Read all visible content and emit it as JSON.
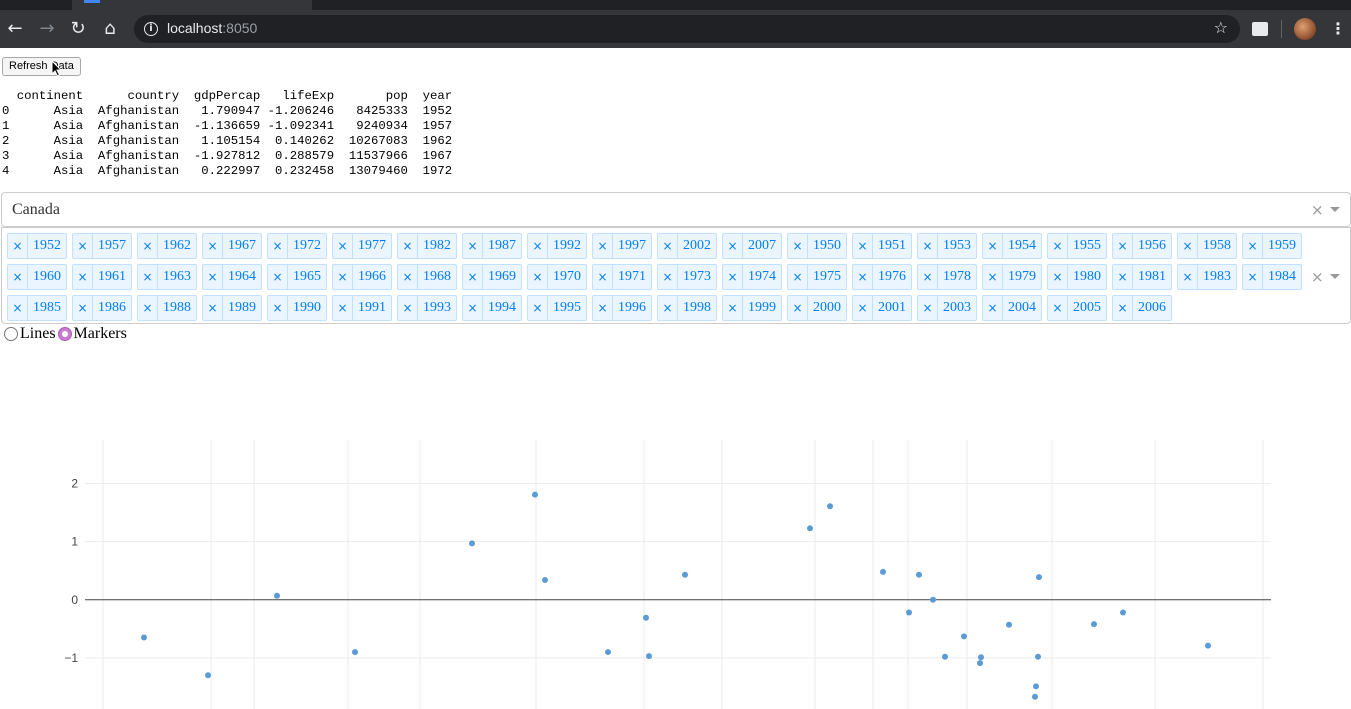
{
  "browser": {
    "url_host": "localhost",
    "url_port": ":8050"
  },
  "refresh_button": {
    "label": "Refresh Data"
  },
  "dataframe_preview": {
    "text": "  continent      country  gdpPercap   lifeExp       pop  year\n0      Asia  Afghanistan   1.790947 -1.206246   8425333  1952\n1      Asia  Afghanistan  -1.136659 -1.092341   9240934  1957\n2      Asia  Afghanistan   1.105154  0.140262  10267083  1962\n3      Asia  Afghanistan  -1.927812  0.288579  11537966  1967\n4      Asia  Afghanistan   0.222997  0.232458  13079460  1972"
  },
  "country_dropdown": {
    "selected": "Canada",
    "clear_glyph": "×"
  },
  "year_dropdown": {
    "clear_glyph": "×",
    "chip_remove_glyph": "×",
    "selected": [
      "1952",
      "1957",
      "1962",
      "1967",
      "1972",
      "1977",
      "1982",
      "1987",
      "1992",
      "1997",
      "2002",
      "2007",
      "1950",
      "1951",
      "1953",
      "1954",
      "1955",
      "1956",
      "1958",
      "1959",
      "1960",
      "1961",
      "1963",
      "1964",
      "1965",
      "1966",
      "1968",
      "1969",
      "1970",
      "1971",
      "1973",
      "1974",
      "1975",
      "1976",
      "1978",
      "1979",
      "1980",
      "1981",
      "1983",
      "1984",
      "1985",
      "1986",
      "1988",
      "1989",
      "1990",
      "1991",
      "1993",
      "1994",
      "1995",
      "1996",
      "1998",
      "1999",
      "2000",
      "2001",
      "2003",
      "2004",
      "2005",
      "2006"
    ]
  },
  "mode_radio": {
    "options": [
      {
        "label": "Lines",
        "checked": false
      },
      {
        "label": "Markers",
        "checked": true
      }
    ]
  },
  "chart_data": {
    "type": "scatter",
    "y_ticks": [
      "2",
      "1",
      "0",
      "−1"
    ],
    "y_tick_values": [
      2,
      1,
      0,
      -1
    ],
    "ylim": [
      -1.88,
      2.75
    ],
    "grid": true,
    "marker_color": "#5b9bd5",
    "points": [
      {
        "x": 144,
        "y": -0.65
      },
      {
        "x": 208,
        "y": -1.3
      },
      {
        "x": 277,
        "y": 0.07
      },
      {
        "x": 355,
        "y": -0.9
      },
      {
        "x": 472,
        "y": 0.97
      },
      {
        "x": 535,
        "y": 1.81
      },
      {
        "x": 545,
        "y": 0.34
      },
      {
        "x": 608,
        "y": -0.9
      },
      {
        "x": 646,
        "y": -0.31
      },
      {
        "x": 649,
        "y": -0.97
      },
      {
        "x": 685,
        "y": 0.43
      },
      {
        "x": 810,
        "y": 1.23
      },
      {
        "x": 830,
        "y": 1.61
      },
      {
        "x": 883,
        "y": 0.48
      },
      {
        "x": 909,
        "y": -0.22
      },
      {
        "x": 919,
        "y": 0.43
      },
      {
        "x": 933,
        "y": 0.0
      },
      {
        "x": 945,
        "y": -0.98
      },
      {
        "x": 964,
        "y": -0.63
      },
      {
        "x": 980,
        "y": -1.09
      },
      {
        "x": 981,
        "y": -0.99
      },
      {
        "x": 1009,
        "y": -0.43
      },
      {
        "x": 1035,
        "y": -1.67
      },
      {
        "x": 1036,
        "y": -1.49
      },
      {
        "x": 1038,
        "y": -0.98
      },
      {
        "x": 1039,
        "y": 0.39
      },
      {
        "x": 1094,
        "y": -0.42
      },
      {
        "x": 1123,
        "y": -0.22
      },
      {
        "x": 1208,
        "y": -0.79
      }
    ],
    "x_gridlines": [
      103,
      211,
      254,
      348,
      420,
      536,
      644,
      722,
      815,
      873,
      908,
      967,
      1052,
      1155,
      1263
    ],
    "xlim": [
      0,
      1351
    ]
  }
}
